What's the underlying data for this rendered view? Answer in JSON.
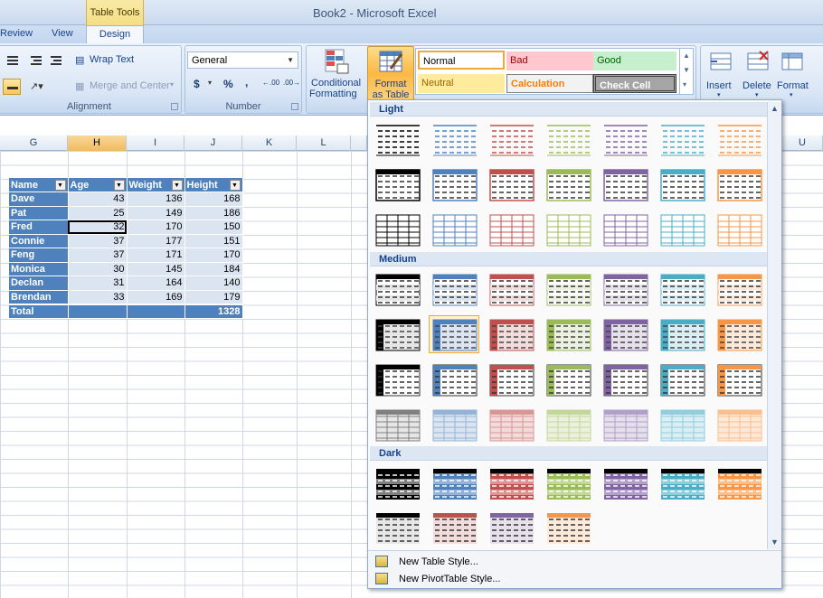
{
  "window": {
    "title": "Book2 - Microsoft Excel"
  },
  "contextual_tab": {
    "group": "Table Tools",
    "tab": "Design"
  },
  "ribbon_tabs": [
    "Review",
    "View"
  ],
  "alignment": {
    "wrap_text": "Wrap Text",
    "merge_center": "Merge and Center",
    "label": "Alignment"
  },
  "number": {
    "format": "General",
    "currency": "$",
    "percent": "%",
    "comma": ",",
    "label": "Number"
  },
  "styles": {
    "conditional_formatting": [
      "Conditional",
      "Formatting"
    ],
    "format_as_table": [
      "Format",
      "as Table"
    ],
    "cell_styles": {
      "normal": "Normal",
      "bad": "Bad",
      "good": "Good",
      "neutral": "Neutral",
      "calculation": "Calculation",
      "check_cell": "Check Cell"
    }
  },
  "cells": {
    "insert": "Insert",
    "delete": "Delete",
    "format": "Format"
  },
  "columns": [
    "G",
    "H",
    "I",
    "J",
    "K",
    "L",
    "U"
  ],
  "selected_column": "H",
  "table": {
    "headers": [
      "Name",
      "Age",
      "Weight",
      "Height"
    ],
    "rows": [
      [
        "Dave",
        "43",
        "136",
        "168"
      ],
      [
        "Pat",
        "25",
        "149",
        "186"
      ],
      [
        "Fred",
        "32",
        "170",
        "150"
      ],
      [
        "Connie",
        "37",
        "177",
        "151"
      ],
      [
        "Feng",
        "37",
        "171",
        "170"
      ],
      [
        "Monica",
        "30",
        "145",
        "184"
      ],
      [
        "Declan",
        "31",
        "164",
        "140"
      ],
      [
        "Brendan",
        "33",
        "169",
        "179"
      ]
    ],
    "total_label": "Total",
    "total_value": "1328",
    "active_cell": "H Fred"
  },
  "table_styles_dropdown": {
    "sections": [
      "Light",
      "Medium",
      "Dark"
    ],
    "palette": [
      "#000000",
      "#4f81bd",
      "#c0504d",
      "#9bbb59",
      "#8064a2",
      "#4bacc6",
      "#f79646"
    ],
    "footer": [
      "New Table Style...",
      "New PivotTable Style..."
    ]
  }
}
